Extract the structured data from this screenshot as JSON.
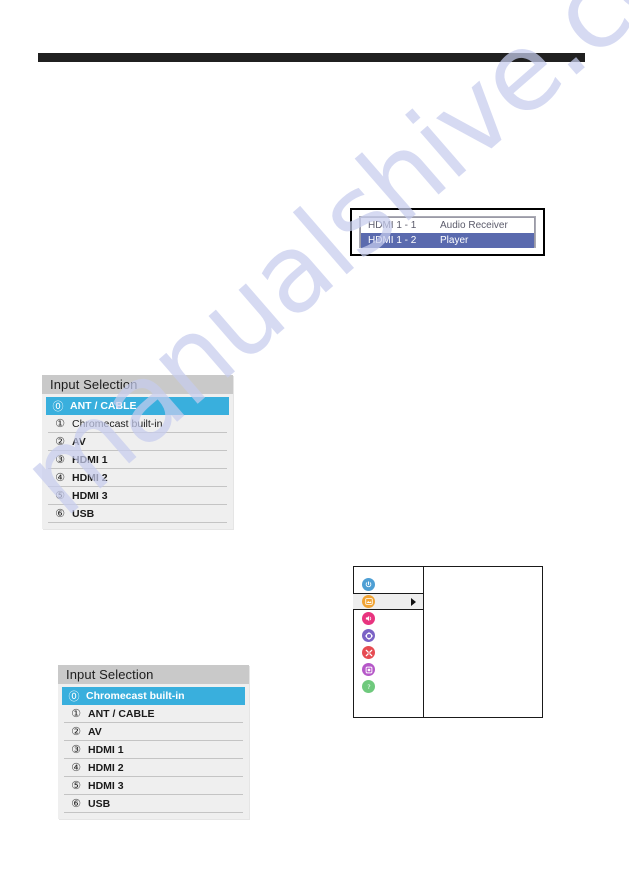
{
  "page": {
    "watermark": "manualshive.com",
    "watermark_color": "#c7cdee",
    "background": "#ffffff"
  },
  "top_rule": {
    "name": "header-rule",
    "color": "#202020"
  },
  "hdmi_dialog": {
    "title": "",
    "rows": [
      {
        "label": "HDMI 1 -  1",
        "value": "Audio Receiver",
        "selected": false
      },
      {
        "label": "HDMI 1 -  2",
        "value": "Player",
        "selected": true
      }
    ],
    "selected_bg": "#5a6aae",
    "unselected_bg": "#ffffff",
    "frame_color": "#9a9aa6"
  },
  "input_menu_1": {
    "title": "Input Selection",
    "highlight_color": "#39afdd",
    "items": [
      {
        "num": "⓪",
        "label": "ANT / CABLE",
        "selected": true
      },
      {
        "num": "①",
        "label": "Chromecast built-in",
        "selected": false
      },
      {
        "num": "②",
        "label": "AV",
        "selected": false
      },
      {
        "num": "③",
        "label": "HDMI 1",
        "selected": false
      },
      {
        "num": "④",
        "label": "HDMI 2",
        "selected": false
      },
      {
        "num": "⑤",
        "label": "HDMI 3",
        "selected": false
      },
      {
        "num": "⑥",
        "label": "USB",
        "selected": false
      }
    ]
  },
  "input_menu_2": {
    "title": "Input Selection",
    "highlight_color": "#39afdd",
    "items": [
      {
        "num": "⓪",
        "label": "Chromecast built-in",
        "selected": true
      },
      {
        "num": "①",
        "label": "ANT / CABLE",
        "selected": false
      },
      {
        "num": "②",
        "label": "AV",
        "selected": false
      },
      {
        "num": "③",
        "label": "HDMI 1",
        "selected": false
      },
      {
        "num": "④",
        "label": "HDMI 2",
        "selected": false
      },
      {
        "num": "⑤",
        "label": "HDMI 3",
        "selected": false
      },
      {
        "num": "⑥",
        "label": "USB",
        "selected": false
      }
    ]
  },
  "icon_panel": {
    "items": [
      {
        "icon": "power-icon",
        "glyph": "⏻",
        "color": "#4e9fd4",
        "active": false
      },
      {
        "icon": "picture-icon",
        "glyph": "▣",
        "color": "#f0a333",
        "active": true
      },
      {
        "icon": "sound-icon",
        "glyph": "◀",
        "color": "#e8347f",
        "active": false
      },
      {
        "icon": "settings-icon",
        "glyph": "⚙",
        "color": "#7b63c6",
        "active": false
      },
      {
        "icon": "tools-icon",
        "glyph": "✖",
        "color": "#e64b52",
        "active": false
      },
      {
        "icon": "lock-icon",
        "glyph": "□",
        "color": "#b558c8",
        "active": false
      },
      {
        "icon": "help-icon",
        "glyph": "?",
        "color": "#6fc97d",
        "active": false
      }
    ],
    "arrow": "▶"
  }
}
